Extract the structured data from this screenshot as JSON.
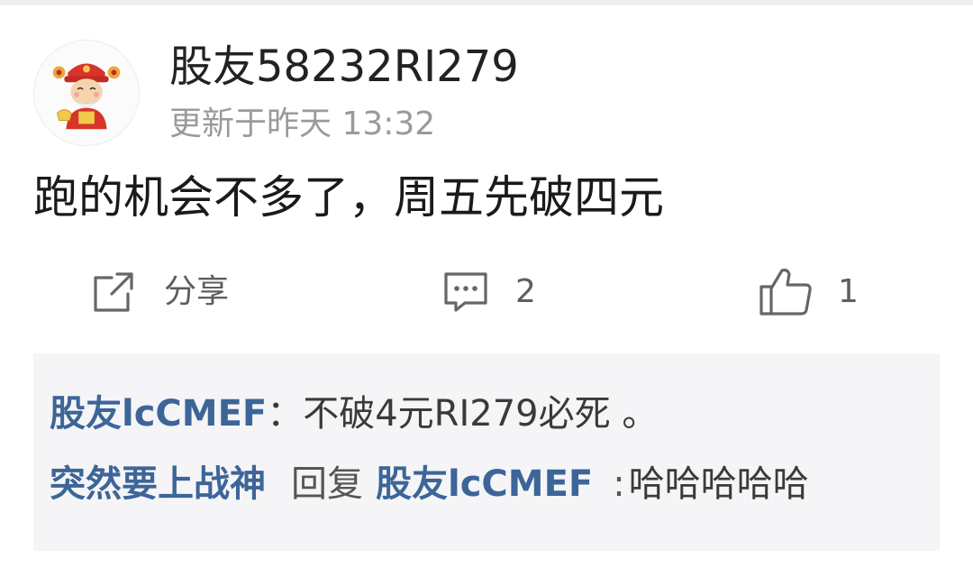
{
  "post": {
    "author": "股友58232RI279",
    "updated_time": "更新于昨天 13:32",
    "content": "跑的机会不多了，周五先破四元",
    "avatar_icon": "god-of-wealth-avatar"
  },
  "actions": {
    "share_label": "分享",
    "share_icon": "share-icon",
    "comment_count": "2",
    "comment_icon": "comment-icon",
    "like_count": "1",
    "like_icon": "thumbs-up-icon"
  },
  "replies": [
    {
      "author": "股友lcCMEF",
      "separator": "：",
      "text": "不破4元RI279必死 。"
    },
    {
      "author": "突然要上战神",
      "reply_word": "回复",
      "target": "股友lcCMEF",
      "separator": ":",
      "text": "哈哈哈哈哈"
    }
  ],
  "colors": {
    "name_link": "#3d6598",
    "reply_box_bg": "#f5f5f7",
    "meta_text": "#9a9a9a"
  }
}
